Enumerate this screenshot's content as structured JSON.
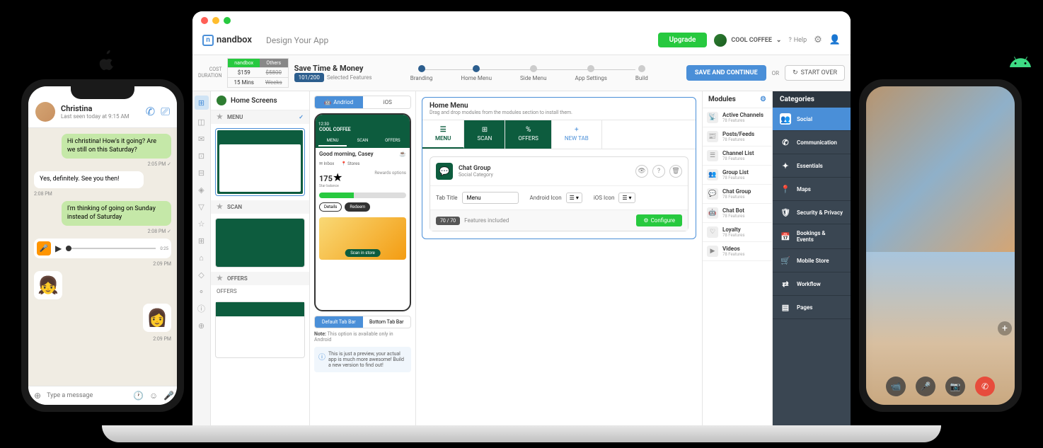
{
  "app": {
    "logo": "nandbox",
    "breadcrumb": "Design Your App",
    "upgrade": "Upgrade",
    "user": "COOL COFFEE",
    "help": "Help"
  },
  "sub": {
    "cost_label": "COST",
    "duration_label": "DURATION",
    "nandbox_hdr": "nandbox",
    "others_hdr": "Others",
    "nandbox_cost": "$159",
    "others_cost": "$5800",
    "nandbox_time": "15 Mins",
    "others_time": "Weeks",
    "save_title": "Save Time & Money",
    "feat_badge": "101/200",
    "feat_text": "Selected Features",
    "steps": [
      "Branding",
      "Home Menu",
      "Side Menu",
      "App Settings",
      "Build"
    ],
    "save_continue": "SAVE AND CONTINUE",
    "or": "OR",
    "start_over": "START OVER"
  },
  "screens": {
    "title": "Home Screens",
    "menu": "MENU",
    "scan": "SCAN",
    "offers": "OFFERS",
    "offers_lbl": "OFFERS"
  },
  "preview": {
    "android": "Andriod",
    "ios": "iOS",
    "app_name": "COOL COFFEE",
    "tab1": "MENU",
    "tab2": "SCAN",
    "tab3": "OFFERS",
    "greeting": "Good morning, Casey",
    "inbox": "Inbox",
    "stores": "Stores",
    "points": "175",
    "star": "★",
    "points_sub": "Star balance",
    "rewards": "Rewards options",
    "details": "Details",
    "redeem": "Redeem",
    "scan_btn": "Scan in store",
    "default_tab": "Default Tab Bar",
    "bottom_tab": "Bottom Tab Bar",
    "note_label": "Note:",
    "note": "This option is available only in Android",
    "preview_note": "This is just a preview, your actual app is much more awesome! Build a new version to find out!"
  },
  "config": {
    "title": "Home Menu",
    "sub": "Drag and drop modules from the modules section to install them.",
    "tabs": [
      "MENU",
      "SCAN",
      "OFFERS",
      "NEW TAB"
    ],
    "module_name": "Chat Group",
    "module_cat": "Social Category",
    "tab_title_lbl": "Tab Title",
    "tab_title_val": "Menu",
    "android_icon": "Android Icon",
    "ios_icon": "iOS Icon",
    "feat_count": "70 / 70",
    "feat_inc": "Features included",
    "configure": "Configure"
  },
  "modules": {
    "title": "Modules",
    "items": [
      {
        "name": "Active Channels",
        "sub": "78 Features"
      },
      {
        "name": "Posts/Feeds",
        "sub": "78 Features"
      },
      {
        "name": "Channel List",
        "sub": "78 Features"
      },
      {
        "name": "Group List",
        "sub": "78 Features"
      },
      {
        "name": "Chat Group",
        "sub": "78 Features"
      },
      {
        "name": "Chat Bot",
        "sub": "78 Features"
      },
      {
        "name": "Loyalty",
        "sub": "78 Features"
      },
      {
        "name": "Videos",
        "sub": "78 Features"
      }
    ]
  },
  "categories": {
    "title": "Categories",
    "items": [
      "Social",
      "Communication",
      "Essentials",
      "Maps",
      "Security & Privacy",
      "Bookings & Events",
      "Mobile Store",
      "Workflow",
      "Pages"
    ]
  },
  "chat": {
    "name": "Christina",
    "status": "Last seen today at 9:15 AM",
    "msg1": "Hi christina! How's it going? Are we still on this Saturday?",
    "time1": "2:05 PM ✓",
    "msg2": "Yes, definitely. See you then!",
    "time2": "2:08 PM",
    "msg3": "I'm thinking of going on Sunday instead of Saturday",
    "time3": "2:08 PM ✓",
    "voice_dur": "0:25",
    "time4": "2:09 PM",
    "time5": "2:09 PM",
    "placeholder": "Type a message"
  }
}
